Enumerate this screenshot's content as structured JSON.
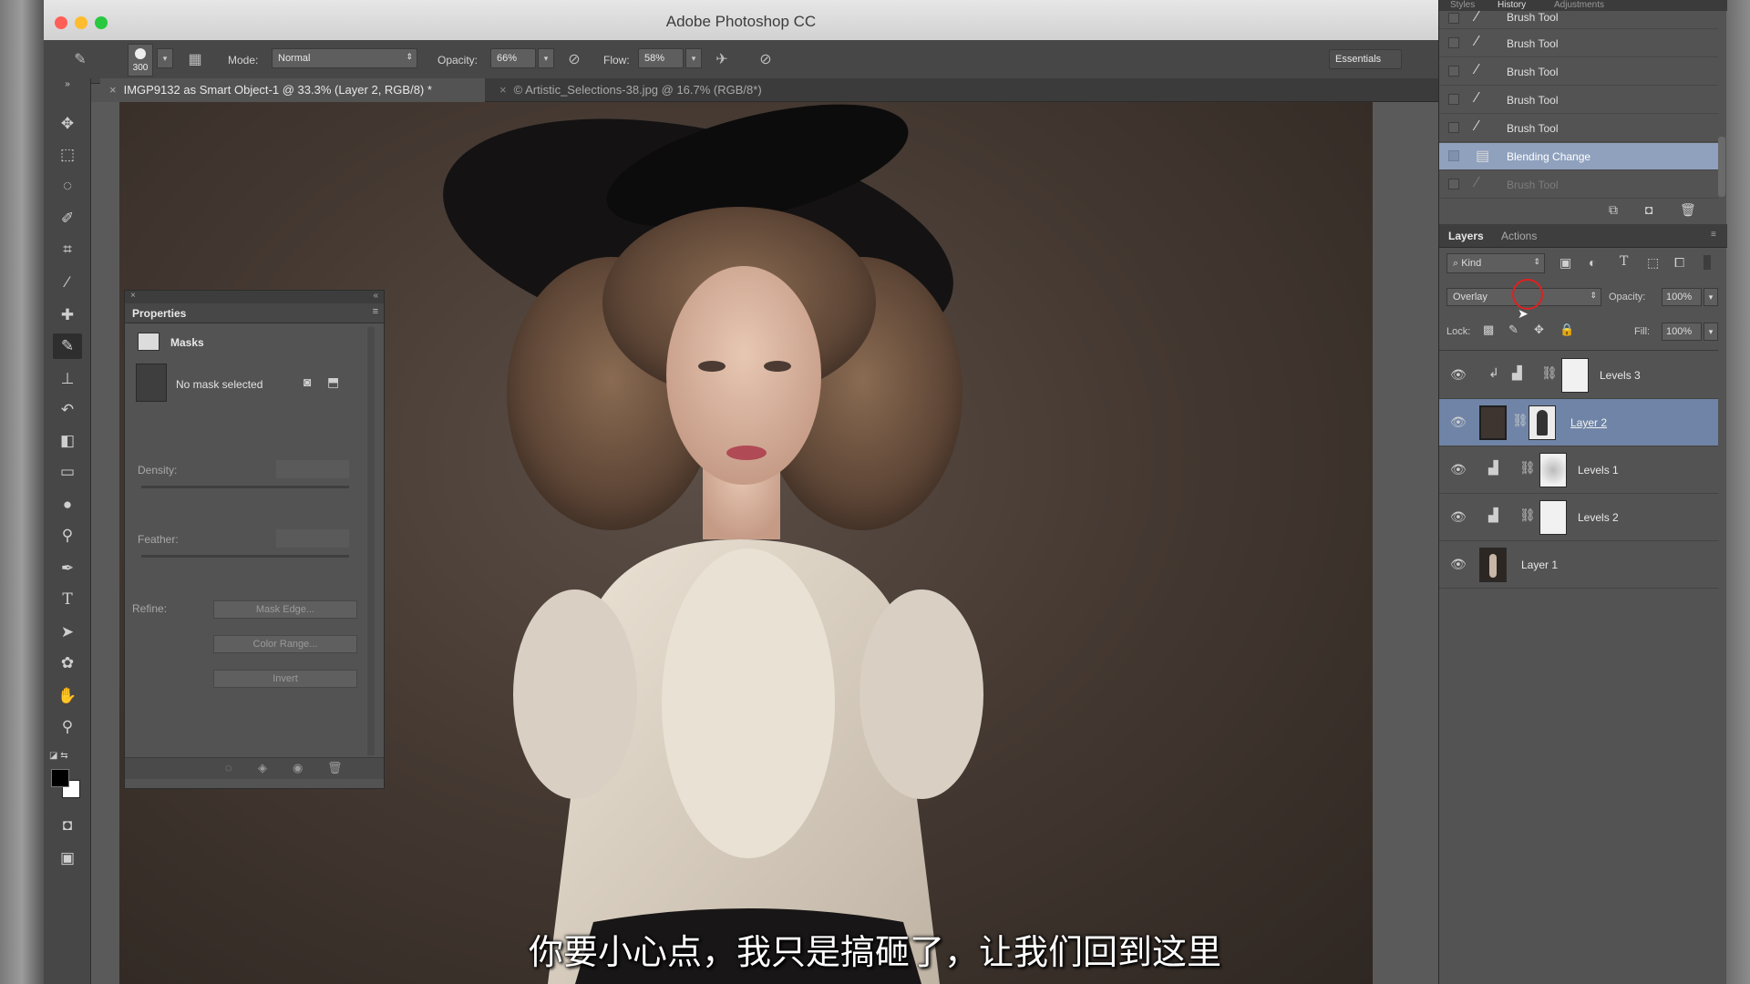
{
  "window": {
    "title": "Adobe Photoshop CC",
    "colors": {
      "close": "#ff5f57",
      "minimize": "#febc2e",
      "maximize": "#28c840"
    }
  },
  "options_bar": {
    "brush_size": "300",
    "mode_label": "Mode:",
    "mode_value": "Normal",
    "opacity_label": "Opacity:",
    "opacity_value": "66%",
    "flow_label": "Flow:",
    "flow_value": "58%",
    "workspace": "Essentials"
  },
  "document_tabs": [
    {
      "label": "IMGP9132 as Smart Object-1 @ 33.3% (Layer 2, RGB/8) *",
      "active": true
    },
    {
      "label": "© Artistic_Selections-38.jpg @ 16.7% (RGB/8*)",
      "active": false
    }
  ],
  "tools": [
    "move-tool-icon",
    "marquee-icon",
    "lasso-icon",
    "quick-select-icon",
    "crop-icon",
    "eyedropper-icon",
    "healing-icon",
    "brush-icon",
    "stamp-icon",
    "history-brush-icon",
    "eraser-icon",
    "gradient-icon",
    "blur-icon",
    "dodge-icon",
    "pen-icon",
    "type-icon",
    "path-select-icon",
    "shape-icon",
    "hand-icon",
    "zoom-icon"
  ],
  "properties": {
    "title": "Properties",
    "section": "Masks",
    "mask_status": "No mask selected",
    "density_label": "Density:",
    "feather_label": "Feather:",
    "refine_label": "Refine:",
    "buttons": [
      "Mask Edge...",
      "Color Range...",
      "Invert"
    ]
  },
  "history": {
    "tabs": [
      "Styles",
      "History",
      "Adjustments"
    ],
    "items": [
      {
        "label": "Brush Tool",
        "selected": false
      },
      {
        "label": "Brush Tool",
        "selected": false
      },
      {
        "label": "Brush Tool",
        "selected": false
      },
      {
        "label": "Brush Tool",
        "selected": false
      },
      {
        "label": "Brush Tool",
        "selected": false
      },
      {
        "label": "Blending Change",
        "selected": true
      },
      {
        "label": "Brush Tool",
        "selected": false
      }
    ]
  },
  "layers": {
    "tabs": [
      "Layers",
      "Actions"
    ],
    "filter_kind": "Kind",
    "blend_mode": "Overlay",
    "opacity_label": "Opacity:",
    "opacity_value": "100%",
    "lock_label": "Lock:",
    "fill_label": "Fill:",
    "fill_value": "100%",
    "items": [
      {
        "name": "Levels 3",
        "type": "adjustment",
        "selected": false
      },
      {
        "name": "Layer 2",
        "type": "pixel",
        "selected": true
      },
      {
        "name": "Levels 1",
        "type": "adjustment",
        "selected": false
      },
      {
        "name": "Levels 2",
        "type": "adjustment",
        "selected": false
      },
      {
        "name": "Layer 1",
        "type": "pixel",
        "selected": false
      }
    ]
  },
  "subtitle": "你要小心点，我只是搞砸了，让我们回到这里"
}
